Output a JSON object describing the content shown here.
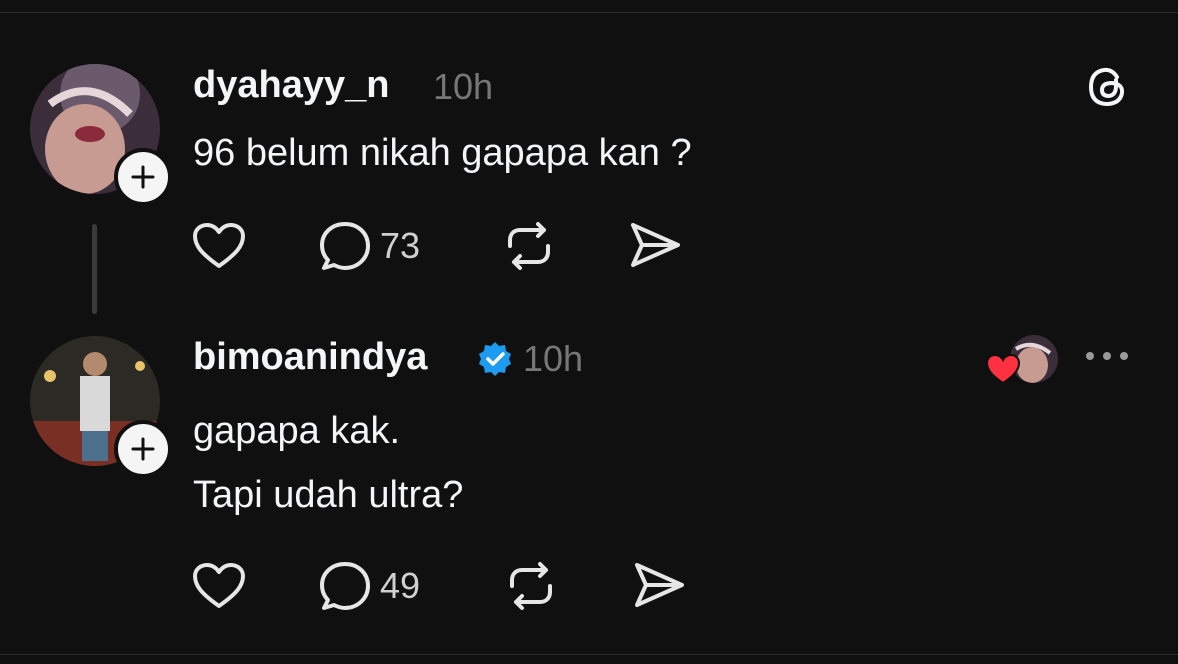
{
  "posts": [
    {
      "username": "dyahayy_n",
      "time": "10h",
      "lines": [
        "96 belum nikah gapapa kan ?"
      ],
      "reply_count": "73",
      "icons": [
        "heart-icon",
        "comment-icon",
        "repost-icon",
        "share-icon"
      ]
    },
    {
      "username": "bimoanindya",
      "verified": true,
      "time": "10h",
      "lines": [
        "gapapa kak.",
        "Tapi udah ultra?"
      ],
      "reply_count": "49",
      "icons": [
        "heart-icon",
        "comment-icon",
        "repost-icon",
        "share-icon"
      ]
    }
  ],
  "header_icon": "threads-logo-icon",
  "colors": {
    "background": "#101010",
    "text": "#f3f5f7",
    "muted": "#777777",
    "verified": "#1d9bf0",
    "like": "#ff3040"
  }
}
